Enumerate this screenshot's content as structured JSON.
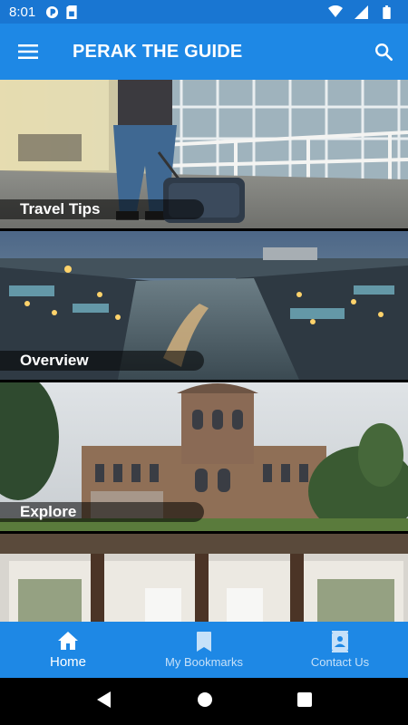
{
  "status_bar": {
    "time": "8:01",
    "icons": [
      "app-notification-icon",
      "sim-card-icon",
      "wifi-icon",
      "signal-icon",
      "battery-icon"
    ]
  },
  "app_bar": {
    "title": "PERAK THE GUIDE",
    "menu_icon": "hamburger-menu-icon",
    "search_icon": "search-icon"
  },
  "cards": [
    {
      "label": "Travel Tips",
      "scene": "airport-traveler-with-luggage"
    },
    {
      "label": "Overview",
      "scene": "river-town-at-dusk"
    },
    {
      "label": "Explore",
      "scene": "colonial-castle-ruins"
    },
    {
      "label": "",
      "scene": "resort-room-interior"
    }
  ],
  "bottom_nav": {
    "items": [
      {
        "label": "Home",
        "icon": "home-icon",
        "active": true
      },
      {
        "label": "My Bookmarks",
        "icon": "bookmark-icon",
        "active": false
      },
      {
        "label": "Contact Us",
        "icon": "contact-book-icon",
        "active": false
      }
    ]
  },
  "colors": {
    "primary": "#1e88e5",
    "status_bar": "#1976d2",
    "nav_active": "#ffffff"
  }
}
